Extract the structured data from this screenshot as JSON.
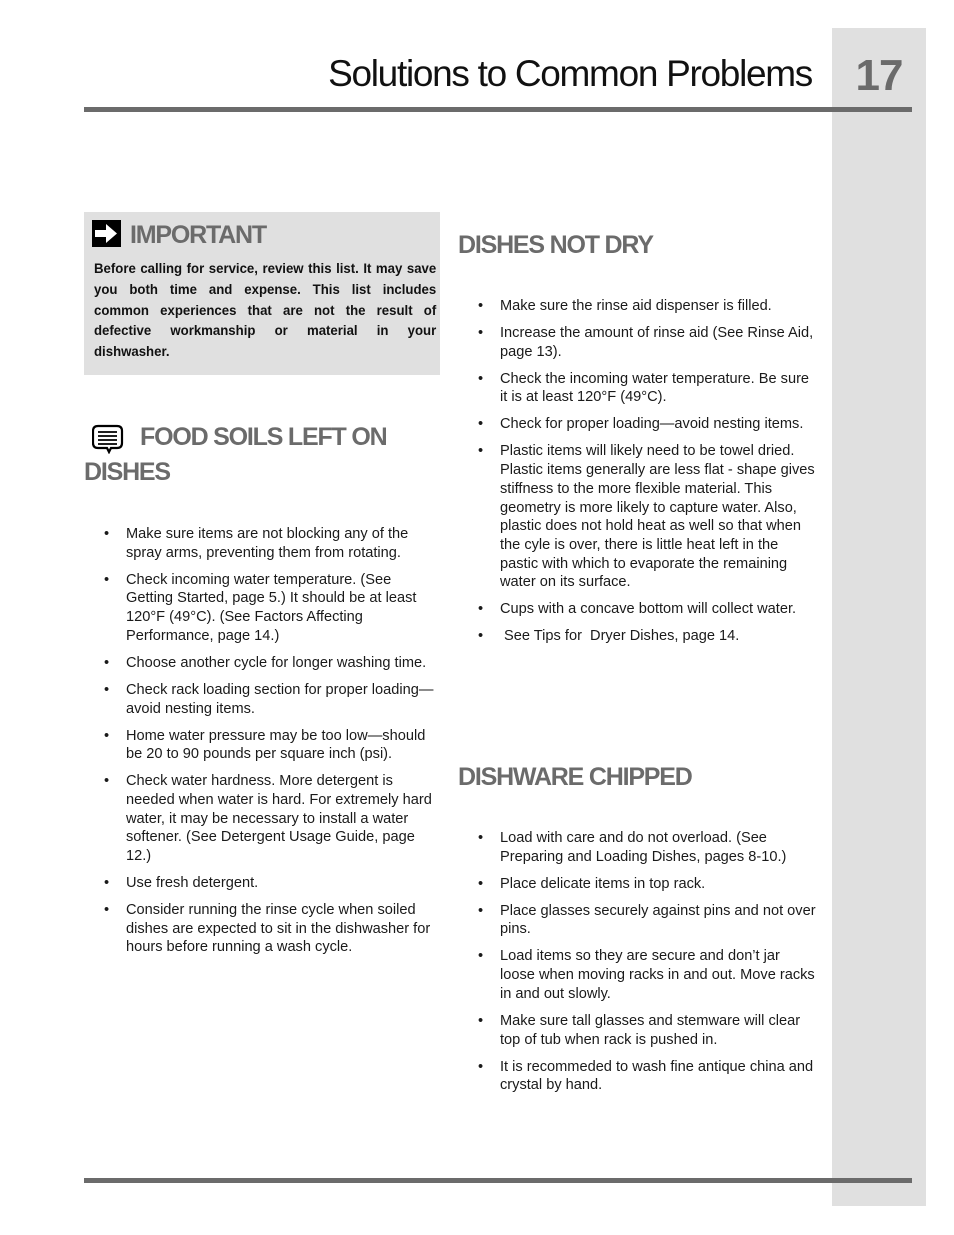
{
  "header": {
    "title": "Solutions to Common Problems",
    "page_number": "17"
  },
  "important": {
    "icon": "arrow-right-icon",
    "heading": "IMPORTANT",
    "text": "Before calling for service, review this list. It may save you both time and expense. This list includes common experiences that are not the result of defective workmanship or material in your dishwasher."
  },
  "sections": {
    "food_soils": {
      "icon": "note-speech-bubble-icon",
      "heading_line1": "FOOD SOILS LEFT ON",
      "heading_line2": "DISHES",
      "items": [
        "Make sure items are not blocking any of the spray arms, preventing them from rotating.",
        "Check incoming water temperature. (See Getting Started, page 5.) It should be at least 120°F (49°C). (See Factors Affecting Performance, page 14.)",
        "Choose another cycle for longer washing time.",
        "Check rack loading section for proper loading—avoid nesting items.",
        "Home water pressure may be too low—should be 20 to 90 pounds per square inch (psi).",
        "Check water hardness.  More detergent is needed when water is hard.  For extremely hard water, it may be necessary to install a water softener. (See Detergent Usage Guide, page 12.)",
        "Use fresh detergent.",
        "Consider running the rinse cycle when soiled dishes are expected to sit in the dishwasher for hours before running a wash cycle."
      ]
    },
    "dishes_not_dry": {
      "heading": "DISHES NOT DRY",
      "items": [
        "Make sure the rinse aid dispenser is filled.",
        "Increase the amount of rinse aid (See Rinse Aid, page 13).",
        "Check the incoming water temperature. Be sure it is at least 120°F (49°C).",
        "Check for proper loading—avoid nesting items.",
        "Plastic items will likely need to be towel dried.  Plastic items generally are less flat - shape gives stiffness to the more flexible material.  This geometry is more likely to capture water.  Also, plastic does not hold heat as well so that when the cyle is over, there is little heat left in the pastic with which to evaporate the remaining water on its surface.",
        "Cups with a concave bottom will collect water.",
        " See Tips for  Dryer Dishes, page 14."
      ]
    },
    "dishware_chipped": {
      "heading": "DISHWARE CHIPPED",
      "items": [
        "Load with care and do not overload. (See Preparing and Loading Dishes, pages 8-10.)",
        "Place delicate items in top rack.",
        "Place glasses securely against pins and not over pins.",
        "Load items so they are secure and don’t jar loose when moving racks in and out. Move racks in and out slowly.",
        "Make sure tall glasses and stemware will clear top of tub when rack is pushed in.",
        "It is recommeded to wash fine antique china and crystal by hand."
      ]
    }
  },
  "bullet_glyph": "•"
}
